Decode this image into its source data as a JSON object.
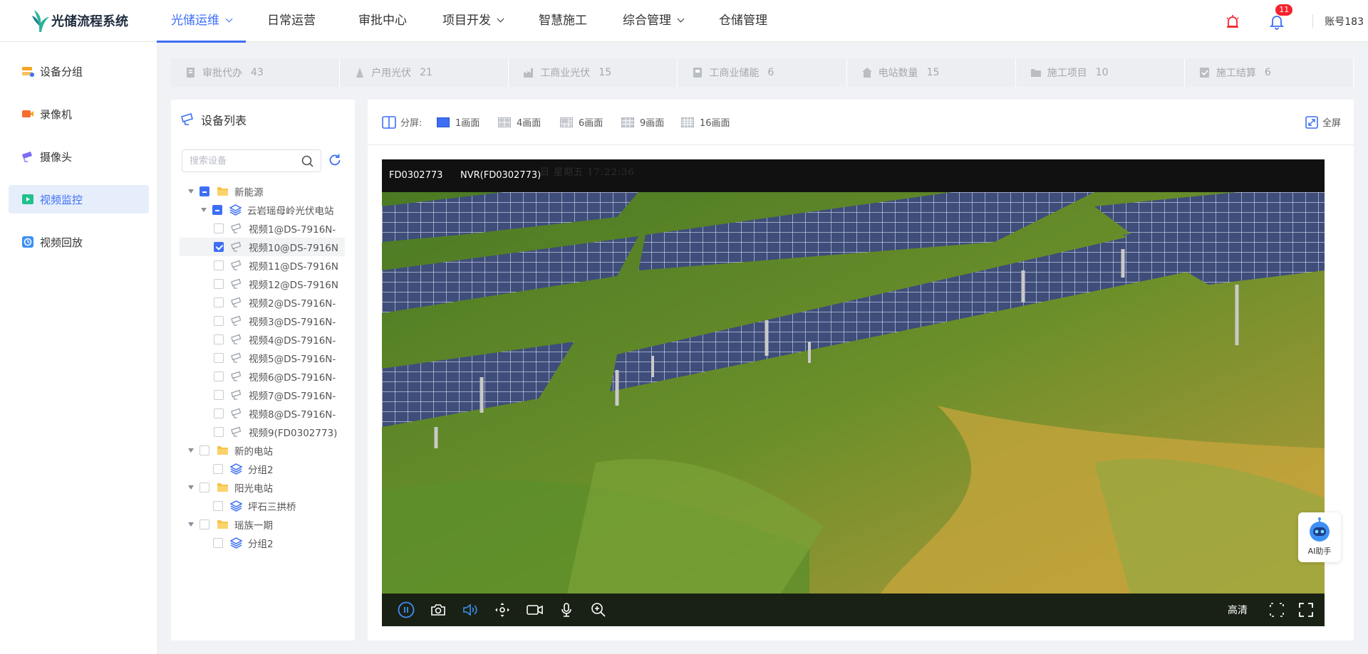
{
  "app": {
    "title": "光储流程系统"
  },
  "nav": [
    {
      "label": "光储运维",
      "dropdown": true,
      "active": true
    },
    {
      "label": "日常运营",
      "dropdown": false
    },
    {
      "label": "审批中心",
      "dropdown": false
    },
    {
      "label": "项目开发",
      "dropdown": true
    },
    {
      "label": "智慧施工",
      "dropdown": false
    },
    {
      "label": "综合管理",
      "dropdown": true
    },
    {
      "label": "仓储管理",
      "dropdown": false
    }
  ],
  "header": {
    "notification_count": "11",
    "account": "账号183"
  },
  "sidebar": {
    "items": [
      {
        "label": "设备分组",
        "icon": "device-group-icon"
      },
      {
        "label": "录像机",
        "icon": "recorder-icon"
      },
      {
        "label": "摄像头",
        "icon": "camera-icon"
      },
      {
        "label": "视频监控",
        "icon": "video-monitor-icon",
        "active": true
      },
      {
        "label": "视频回放",
        "icon": "video-playback-icon"
      }
    ]
  },
  "stats": [
    {
      "label": "审批代办",
      "count": "43"
    },
    {
      "label": "户用光伏",
      "count": "21"
    },
    {
      "label": "工商业光伏",
      "count": "15"
    },
    {
      "label": "工商业储能",
      "count": "6"
    },
    {
      "label": "电站数量",
      "count": "15"
    },
    {
      "label": "施工项目",
      "count": "10"
    },
    {
      "label": "施工结算",
      "count": "6"
    }
  ],
  "device_panel": {
    "title": "设备列表",
    "search_placeholder": "搜索设备",
    "tree": [
      {
        "label": "新能源",
        "level": 0,
        "type": "folder",
        "check": "ind",
        "expanded": true
      },
      {
        "label": "云岩瑶母岭光伏电站",
        "level": 1,
        "type": "station",
        "check": "ind",
        "expanded": true
      },
      {
        "label": "视频1@DS-7916N-",
        "level": 2,
        "type": "camera",
        "check": "none"
      },
      {
        "label": "视频10@DS-7916N",
        "level": 2,
        "type": "camera",
        "check": "chk",
        "selected": true
      },
      {
        "label": "视频11@DS-7916N",
        "level": 2,
        "type": "camera",
        "check": "none"
      },
      {
        "label": "视频12@DS-7916N",
        "level": 2,
        "type": "camera",
        "check": "none"
      },
      {
        "label": "视频2@DS-7916N-",
        "level": 2,
        "type": "camera",
        "check": "none"
      },
      {
        "label": "视频3@DS-7916N-",
        "level": 2,
        "type": "camera",
        "check": "none"
      },
      {
        "label": "视频4@DS-7916N-",
        "level": 2,
        "type": "camera",
        "check": "none"
      },
      {
        "label": "视频5@DS-7916N-",
        "level": 2,
        "type": "camera",
        "check": "none"
      },
      {
        "label": "视频6@DS-7916N-",
        "level": 2,
        "type": "camera",
        "check": "none"
      },
      {
        "label": "视频7@DS-7916N-",
        "level": 2,
        "type": "camera",
        "check": "none"
      },
      {
        "label": "视频8@DS-7916N-",
        "level": 2,
        "type": "camera",
        "check": "none"
      },
      {
        "label": "视频9(FD0302773)",
        "level": 2,
        "type": "camera",
        "check": "none"
      },
      {
        "label": "新的电站",
        "level": 0,
        "type": "folder",
        "check": "none",
        "expanded": true
      },
      {
        "label": "分组2",
        "level": 1,
        "type": "station",
        "check": "none"
      },
      {
        "label": "阳光电站",
        "level": 0,
        "type": "folder",
        "check": "none",
        "expanded": true
      },
      {
        "label": "坪石三拱桥",
        "level": 1,
        "type": "station",
        "check": "none"
      },
      {
        "label": "瑶族一期",
        "level": 0,
        "type": "folder",
        "check": "none",
        "expanded": true
      },
      {
        "label": "分组2",
        "level": 1,
        "type": "station",
        "check": "none"
      }
    ]
  },
  "viewer": {
    "split_label": "分屏:",
    "layouts": [
      {
        "label": "1画面",
        "active": true
      },
      {
        "label": "4画面"
      },
      {
        "label": "6画面"
      },
      {
        "label": "9画面"
      },
      {
        "label": "16画面"
      }
    ],
    "fullscreen_label": "全屏",
    "stream": {
      "device_id": "FD0302773",
      "nvr": "NVR(FD0302773)",
      "osd_text": "日  星期五  17:22:36"
    },
    "quality_label": "高清"
  },
  "ai_assistant": {
    "label": "AI助手"
  },
  "colors": {
    "accent": "#3d6ff5",
    "badge": "#f5222d",
    "alarm": "#f5222d"
  }
}
